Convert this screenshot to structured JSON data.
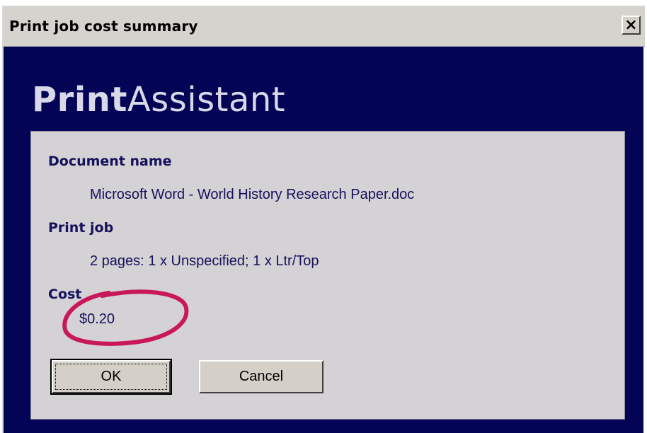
{
  "window": {
    "title": "Print job cost summary",
    "close_label": "×"
  },
  "brand": {
    "bold_part": "Print",
    "regular_part": "Assistant"
  },
  "details": {
    "document_heading": "Document name",
    "document_value": "Microsoft Word - World History Research Paper.doc",
    "printjob_heading": "Print job",
    "printjob_value": "2 pages: 1 x Unspecified; 1 x Ltr/Top",
    "cost_heading": "Cost",
    "cost_value": "$0.20"
  },
  "buttons": {
    "ok_label": "OK",
    "cancel_label": "Cancel"
  },
  "colors": {
    "window_background": "#040456",
    "panel_background": "#d4d2d4",
    "text": "#15115c",
    "annotation_circle": "#c8185a"
  },
  "icons": {
    "close": "close-icon"
  }
}
